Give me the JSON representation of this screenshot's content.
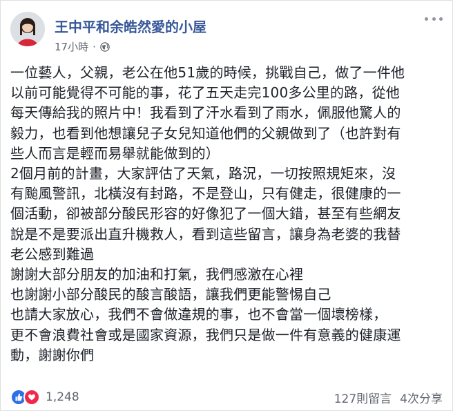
{
  "post": {
    "author": "王中平和余皓然愛的小屋",
    "timestamp": "17小時",
    "separator": "·",
    "privacy_icon": "globe-icon",
    "menu_icon": "more-options-icon"
  },
  "content": {
    "paragraphs": [
      {
        "lines": [
          "一位藝人，父親，老公在他51歲的時候，挑戰自己，做了一件他",
          "以前可能覺得不可能的事，花了五天走完100多公里的路，從他",
          "每天傳給我的照片中！我看到了汗水看到了雨水，佩服他驚人的",
          "毅力，也看到他想讓兒子女兒知道他們的父親做到了（也許對有",
          "些人而言是輕而易舉就能做到的）"
        ]
      },
      {
        "lines": [
          "2個月前的計畫，大家評估了天氣，路況，一切按照規矩來，沒",
          "有颱風警訊，北橫沒有封路，不是登山，只有健走，很健康的一",
          "個活動，卻被部分酸民形容的好像犯了一個大錯，甚至有些網友",
          "說是不是要派出直升機救人，看到這些留言，讓身為老婆的我替",
          "老公感到難過"
        ]
      },
      {
        "lines": [
          "謝謝大部分朋友的加油和打氣，我們感激在心裡"
        ]
      },
      {
        "lines": [
          "也謝謝小部分酸民的酸言酸語，讓我們更能警惕自己"
        ]
      },
      {
        "lines": [
          "也請大家放心，我們不會做違規的事，也不會當一個壞榜樣，",
          "更不會浪費社會或是國家資源，我們只是做一件有意義的健康運",
          "動，謝謝你們"
        ]
      }
    ]
  },
  "footer": {
    "reaction_icons": [
      "like-icon",
      "love-icon"
    ],
    "reaction_count": "1,248",
    "comments": "127則留言",
    "shares": "4次分享"
  },
  "colors": {
    "author": "#365899",
    "meta": "#616770",
    "text": "#1d2129",
    "like": "#2c6fe7",
    "love": "#f0284a"
  }
}
